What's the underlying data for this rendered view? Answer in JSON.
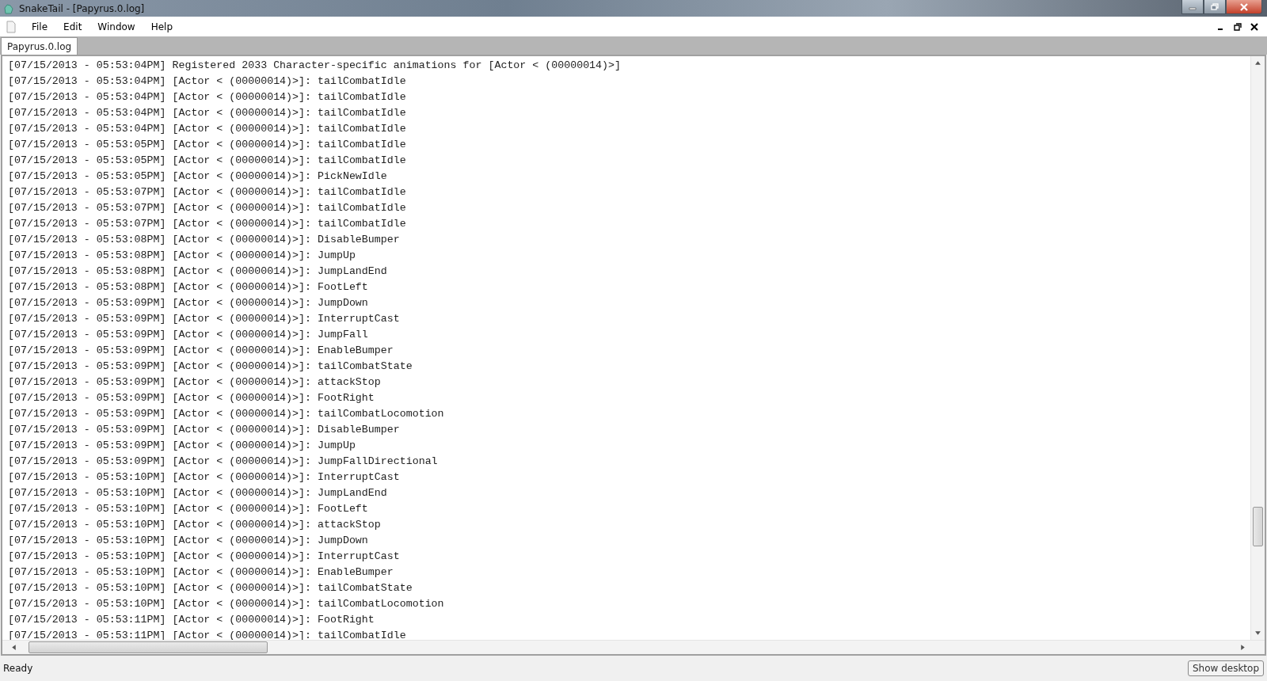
{
  "window": {
    "title": "SnakeTail - [Papyrus.0.log]"
  },
  "menu": [
    "File",
    "Edit",
    "Window",
    "Help"
  ],
  "tabs": [
    {
      "label": "Papyrus.0.log",
      "selected": true
    }
  ],
  "log_lines": [
    "[07/15/2013 - 05:53:04PM] Registered 2033 Character-specific animations for [Actor < (00000014)>]",
    "[07/15/2013 - 05:53:04PM] [Actor < (00000014)>]: tailCombatIdle",
    "[07/15/2013 - 05:53:04PM] [Actor < (00000014)>]: tailCombatIdle",
    "[07/15/2013 - 05:53:04PM] [Actor < (00000014)>]: tailCombatIdle",
    "[07/15/2013 - 05:53:04PM] [Actor < (00000014)>]: tailCombatIdle",
    "[07/15/2013 - 05:53:05PM] [Actor < (00000014)>]: tailCombatIdle",
    "[07/15/2013 - 05:53:05PM] [Actor < (00000014)>]: tailCombatIdle",
    "[07/15/2013 - 05:53:05PM] [Actor < (00000014)>]: PickNewIdle",
    "[07/15/2013 - 05:53:07PM] [Actor < (00000014)>]: tailCombatIdle",
    "[07/15/2013 - 05:53:07PM] [Actor < (00000014)>]: tailCombatIdle",
    "[07/15/2013 - 05:53:07PM] [Actor < (00000014)>]: tailCombatIdle",
    "[07/15/2013 - 05:53:08PM] [Actor < (00000014)>]: DisableBumper",
    "[07/15/2013 - 05:53:08PM] [Actor < (00000014)>]: JumpUp",
    "[07/15/2013 - 05:53:08PM] [Actor < (00000014)>]: JumpLandEnd",
    "[07/15/2013 - 05:53:08PM] [Actor < (00000014)>]: FootLeft",
    "[07/15/2013 - 05:53:09PM] [Actor < (00000014)>]: JumpDown",
    "[07/15/2013 - 05:53:09PM] [Actor < (00000014)>]: InterruptCast",
    "[07/15/2013 - 05:53:09PM] [Actor < (00000014)>]: JumpFall",
    "[07/15/2013 - 05:53:09PM] [Actor < (00000014)>]: EnableBumper",
    "[07/15/2013 - 05:53:09PM] [Actor < (00000014)>]: tailCombatState",
    "[07/15/2013 - 05:53:09PM] [Actor < (00000014)>]: attackStop",
    "[07/15/2013 - 05:53:09PM] [Actor < (00000014)>]: FootRight",
    "[07/15/2013 - 05:53:09PM] [Actor < (00000014)>]: tailCombatLocomotion",
    "[07/15/2013 - 05:53:09PM] [Actor < (00000014)>]: DisableBumper",
    "[07/15/2013 - 05:53:09PM] [Actor < (00000014)>]: JumpUp",
    "[07/15/2013 - 05:53:09PM] [Actor < (00000014)>]: JumpFallDirectional",
    "[07/15/2013 - 05:53:10PM] [Actor < (00000014)>]: InterruptCast",
    "[07/15/2013 - 05:53:10PM] [Actor < (00000014)>]: JumpLandEnd",
    "[07/15/2013 - 05:53:10PM] [Actor < (00000014)>]: FootLeft",
    "[07/15/2013 - 05:53:10PM] [Actor < (00000014)>]: attackStop",
    "[07/15/2013 - 05:53:10PM] [Actor < (00000014)>]: JumpDown",
    "[07/15/2013 - 05:53:10PM] [Actor < (00000014)>]: InterruptCast",
    "[07/15/2013 - 05:53:10PM] [Actor < (00000014)>]: EnableBumper",
    "[07/15/2013 - 05:53:10PM] [Actor < (00000014)>]: tailCombatState",
    "[07/15/2013 - 05:53:10PM] [Actor < (00000014)>]: tailCombatLocomotion",
    "[07/15/2013 - 05:53:11PM] [Actor < (00000014)>]: FootRight",
    "[07/15/2013 - 05:53:11PM] [Actor < (00000014)>]: tailCombatIdle"
  ],
  "status_bar": {
    "text": "Ready",
    "button": "Show desktop"
  }
}
